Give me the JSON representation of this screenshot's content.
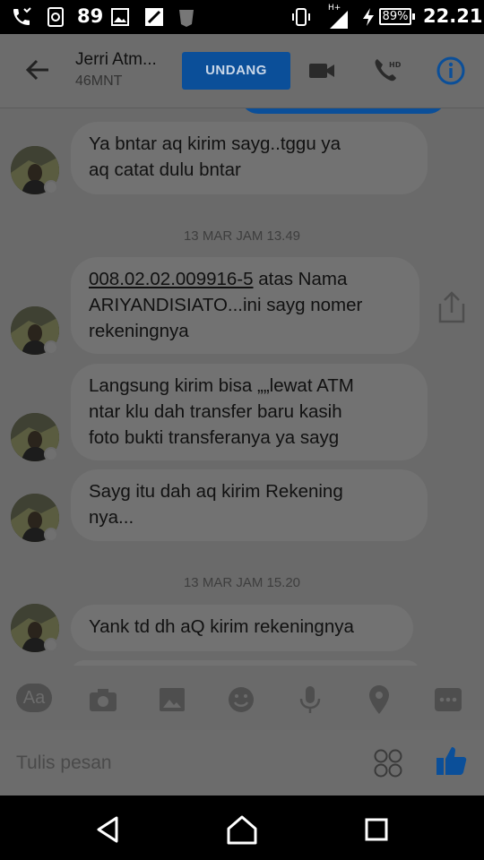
{
  "status_bar": {
    "notification_count": "89",
    "network_type": "H+",
    "battery_percent": "89%",
    "time": "22.21"
  },
  "header": {
    "contact_name": "Jerri Atm...",
    "status": "46MNT",
    "invite_label": "UNDANG"
  },
  "messages": [
    {
      "type": "incoming",
      "text": "Ya bntar aq kirim sayg..tggu ya\naq catat dulu bntar"
    },
    {
      "type": "timestamp",
      "text": "13 MAR JAM 13.49"
    },
    {
      "type": "incoming",
      "account_number": "008.02.02.009916-5",
      "text": " atas Nama\nARIYANDISIATO...ini sayg nomer\nrekeningnya"
    },
    {
      "type": "incoming",
      "text": "Langsung kirim bisa „„lewat ATM\nntar klu dah transfer baru kasih\nfoto bukti transferanya ya sayg"
    },
    {
      "type": "incoming",
      "text": "Sayg itu dah aq kirim Rekening\nnya..."
    },
    {
      "type": "timestamp",
      "text": "13 MAR JAM 15.20"
    },
    {
      "type": "incoming",
      "text": "Yank td dh aQ kirim rekeningnya"
    }
  ],
  "composer": {
    "aa_label": "Aa",
    "placeholder": "Tulis pesan"
  },
  "colors": {
    "invite_button": "#0b4f99",
    "accent_icon": "#0b4f99",
    "overlay_gray": "#6a6a6a",
    "bubble": "#727272"
  },
  "icons": [
    "back-arrow-icon",
    "video-camera-icon",
    "hd-phone-icon",
    "info-icon",
    "share-icon",
    "camera-icon",
    "image-icon",
    "emoji-icon",
    "microphone-icon",
    "location-icon",
    "more-icon",
    "sticker-icon",
    "thumbs-up-icon"
  ]
}
